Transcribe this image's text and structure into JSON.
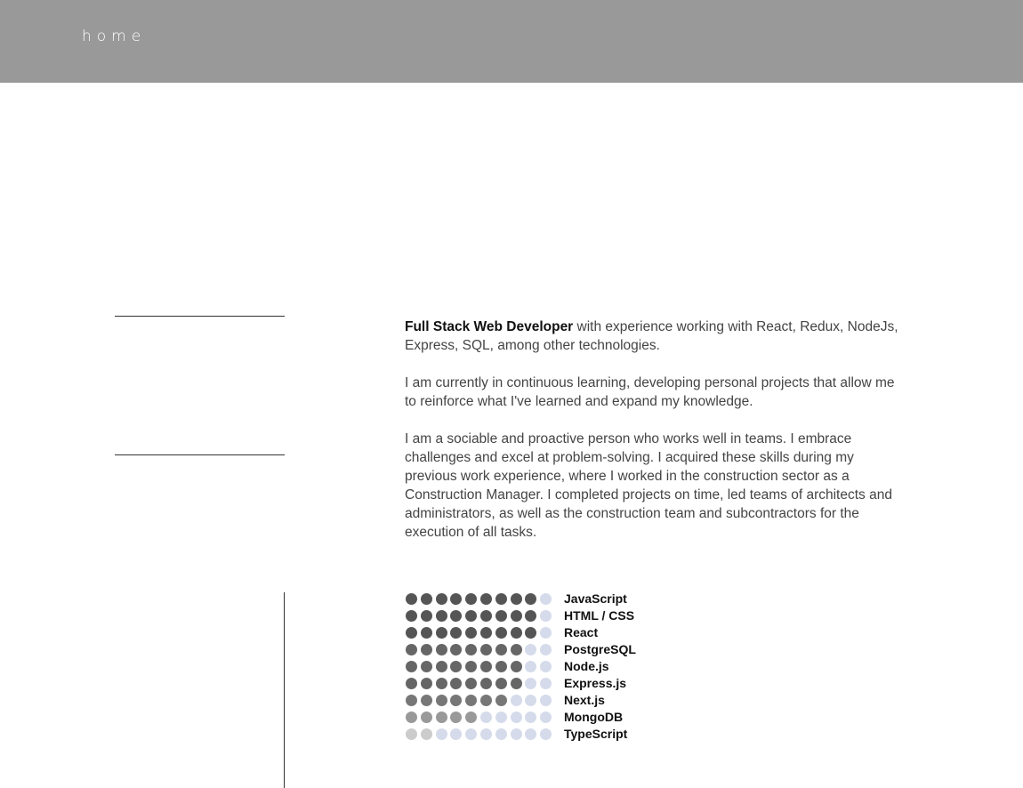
{
  "nav": {
    "home_label": "home"
  },
  "about": {
    "intro_bold": "Full Stack Web Developer",
    "intro_rest": " with experience working with React, Redux, NodeJs, Express, SQL, among other technologies.",
    "paragraph_2": "I am currently in continuous learning, developing personal projects that allow me to reinforce what I've learned and expand my knowledge.",
    "paragraph_3": "I am a sociable and proactive person who works well in teams. I embrace challenges and excel at problem-solving. I acquired these skills during my previous work experience, where I worked in the construction sector as a Construction Manager. I completed projects on time, led teams of architects and administrators, as well as the construction team and subcontractors for the execution of all tasks."
  },
  "colors": {
    "header_bg": "#999999",
    "dot_dark": "#555555",
    "dot_medium": "#666666",
    "dot_mid": "#777777",
    "dot_light": "#999999",
    "dot_grey": "#cccccc",
    "dot_empty": "#d5dbea"
  },
  "skills": [
    {
      "name": "JavaScript",
      "level": 9,
      "max": 10,
      "tone": "dot_dark"
    },
    {
      "name": "HTML / CSS",
      "level": 9,
      "max": 10,
      "tone": "dot_dark"
    },
    {
      "name": "React",
      "level": 9,
      "max": 10,
      "tone": "dot_dark"
    },
    {
      "name": "PostgreSQL",
      "level": 8,
      "max": 10,
      "tone": "dot_medium"
    },
    {
      "name": "Node.js",
      "level": 8,
      "max": 10,
      "tone": "dot_medium"
    },
    {
      "name": "Express.js",
      "level": 8,
      "max": 10,
      "tone": "dot_medium"
    },
    {
      "name": "Next.js",
      "level": 7,
      "max": 10,
      "tone": "dot_mid"
    },
    {
      "name": "MongoDB",
      "level": 5,
      "max": 10,
      "tone": "dot_light"
    },
    {
      "name": "TypeScript",
      "level": 2,
      "max": 10,
      "tone": "dot_grey"
    }
  ]
}
